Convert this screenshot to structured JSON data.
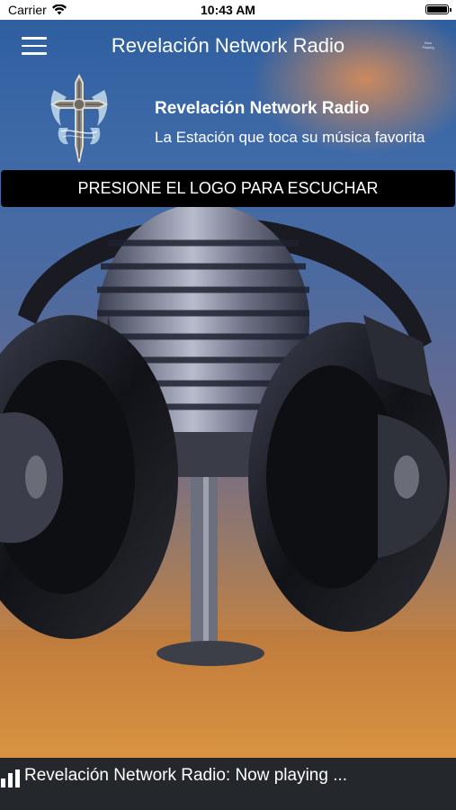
{
  "status_bar": {
    "carrier": "Carrier",
    "time": "10:43 AM",
    "wifi_icon": "wifi-icon",
    "battery_icon": "battery-icon"
  },
  "header": {
    "title": "Revelación Network Radio",
    "menu_icon": "hamburger-menu-icon",
    "mini_logo_text": "Now Playing"
  },
  "station": {
    "name": "Revelación Network Radio",
    "tagline": "La Estación que toca su música favorita",
    "logo_icon": "winged-cross-logo"
  },
  "banner": {
    "text": "PRESIONE EL LOGO PARA ESCUCHAR"
  },
  "now_playing": {
    "text": "Revelación Network Radio: Now playing ...",
    "icon": "equalizer-bars-icon"
  },
  "colors": {
    "now_playing_bar": "#24272c",
    "banner": "#000000",
    "background_top": "#2f5fa0",
    "background_bottom": "#d08a3a"
  }
}
